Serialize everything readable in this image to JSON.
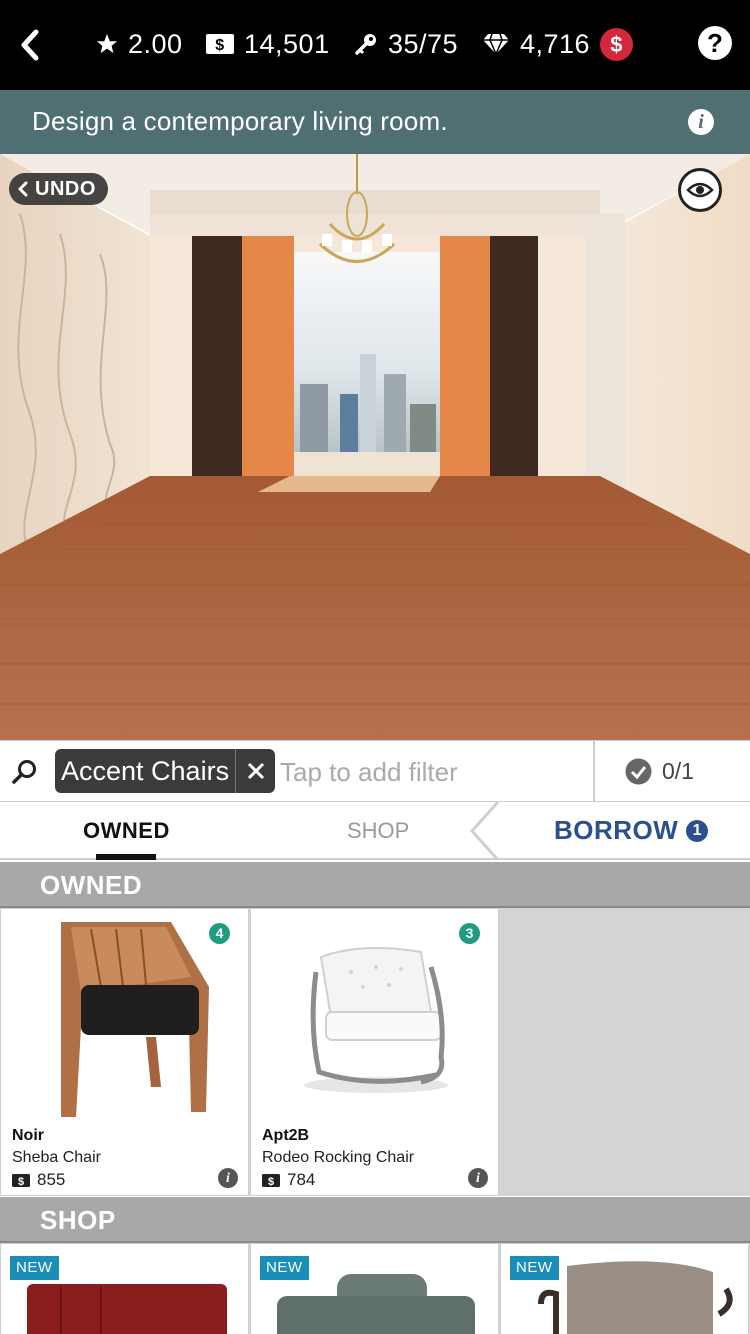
{
  "topbar": {
    "rating": "2.00",
    "coins": "14,501",
    "keys": "35/75",
    "gems": "4,716",
    "plus_label": "$",
    "help_label": "?"
  },
  "task": {
    "text": "Design a contemporary living room.",
    "info_label": "i"
  },
  "room": {
    "undo_label": "UNDO"
  },
  "filter": {
    "chip_label": "Accent Chairs",
    "placeholder": "Tap to add filter",
    "count": "0/1"
  },
  "tabs": {
    "owned": "OWNED",
    "shop": "SHOP",
    "borrow": "BORROW",
    "borrow_badge": "1"
  },
  "owned_section": {
    "title": "OWNED",
    "items": [
      {
        "brand": "Noir",
        "name": "Sheba Chair",
        "price": "855",
        "count": "4"
      },
      {
        "brand": "Apt2B",
        "name": "Rodeo Rocking Chair",
        "price": "784",
        "count": "3"
      }
    ]
  },
  "shop_section": {
    "title": "SHOP",
    "items": [
      {
        "badge": "NEW",
        "color": "#8c1d1d"
      },
      {
        "badge": "NEW",
        "color": "#6b7c78"
      },
      {
        "badge": "NEW",
        "color": "#9a8f86"
      }
    ]
  },
  "colors": {
    "topbar": "#000000",
    "taskbar": "#4f6f73",
    "count_badge": "#1f9d83",
    "borrow": "#2b4f8f",
    "new_badge": "#1a8db8",
    "coin_plus": "#d3283b"
  }
}
